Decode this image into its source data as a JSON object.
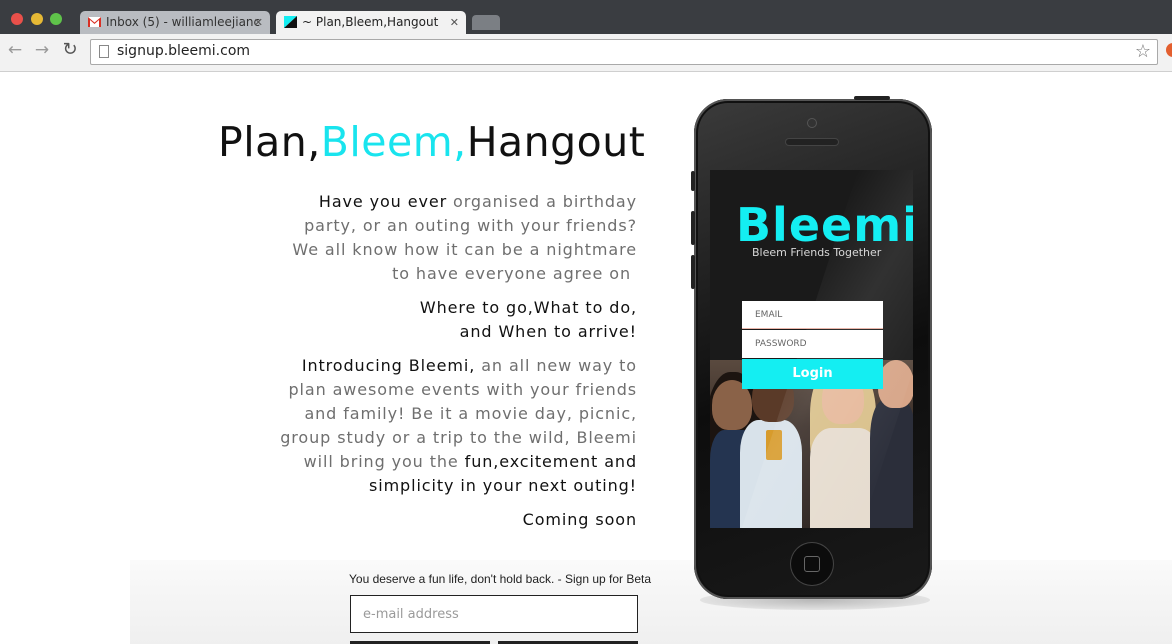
{
  "browser": {
    "tabs": [
      {
        "title": "Inbox (5) - williamleejianc",
        "icon": "gmail-icon"
      },
      {
        "title": "~ Plan,Bleem,Hangout",
        "icon": "bleemi-favicon"
      }
    ],
    "close_glyph": "✕",
    "url": "signup.bleemi.com",
    "nav": {
      "back": "←",
      "forward": "→",
      "reload": "↻",
      "star": "☆"
    }
  },
  "hero": {
    "headline_part1": "Plan,",
    "headline_part2": "Bleem,",
    "headline_part3": "Hangout",
    "accent_color": "#19e4ee"
  },
  "intro": {
    "p1_dark": "Have you ever ",
    "p1_line1_rest": "organised a birthday",
    "p1_line2": "party, or an outing with your friends?",
    "p1_line3": "We all know how it can be a nightmare",
    "p1_line4": "to have everyone agree on ",
    "p2_line1": "Where to go,What to do,",
    "p2_line2": "and When to arrive!",
    "p3_dark": "Introducing Bleemi,",
    "p3_line1_rest": " an all new way to",
    "p3_line2": "plan awesome events with your friends",
    "p3_line3": "and family! Be it a movie day, picnic,",
    "p3_line4": "group study or a trip to the wild, Bleemi",
    "p3_line5_light": "will bring you the ",
    "p3_line5_dark": "fun,excitement and",
    "p3_line6": "simplicity in your next outing!",
    "p4": "Coming soon"
  },
  "signup": {
    "tagline": "You deserve a fun life, don't hold back. - Sign up for Beta",
    "email_placeholder": "e-mail address"
  },
  "phone_app": {
    "logo": "Bleemi",
    "subtitle": "Bleem Friends Together",
    "email_label": "EMAIL",
    "password_label": "PASSWORD",
    "login_label": "Login"
  }
}
